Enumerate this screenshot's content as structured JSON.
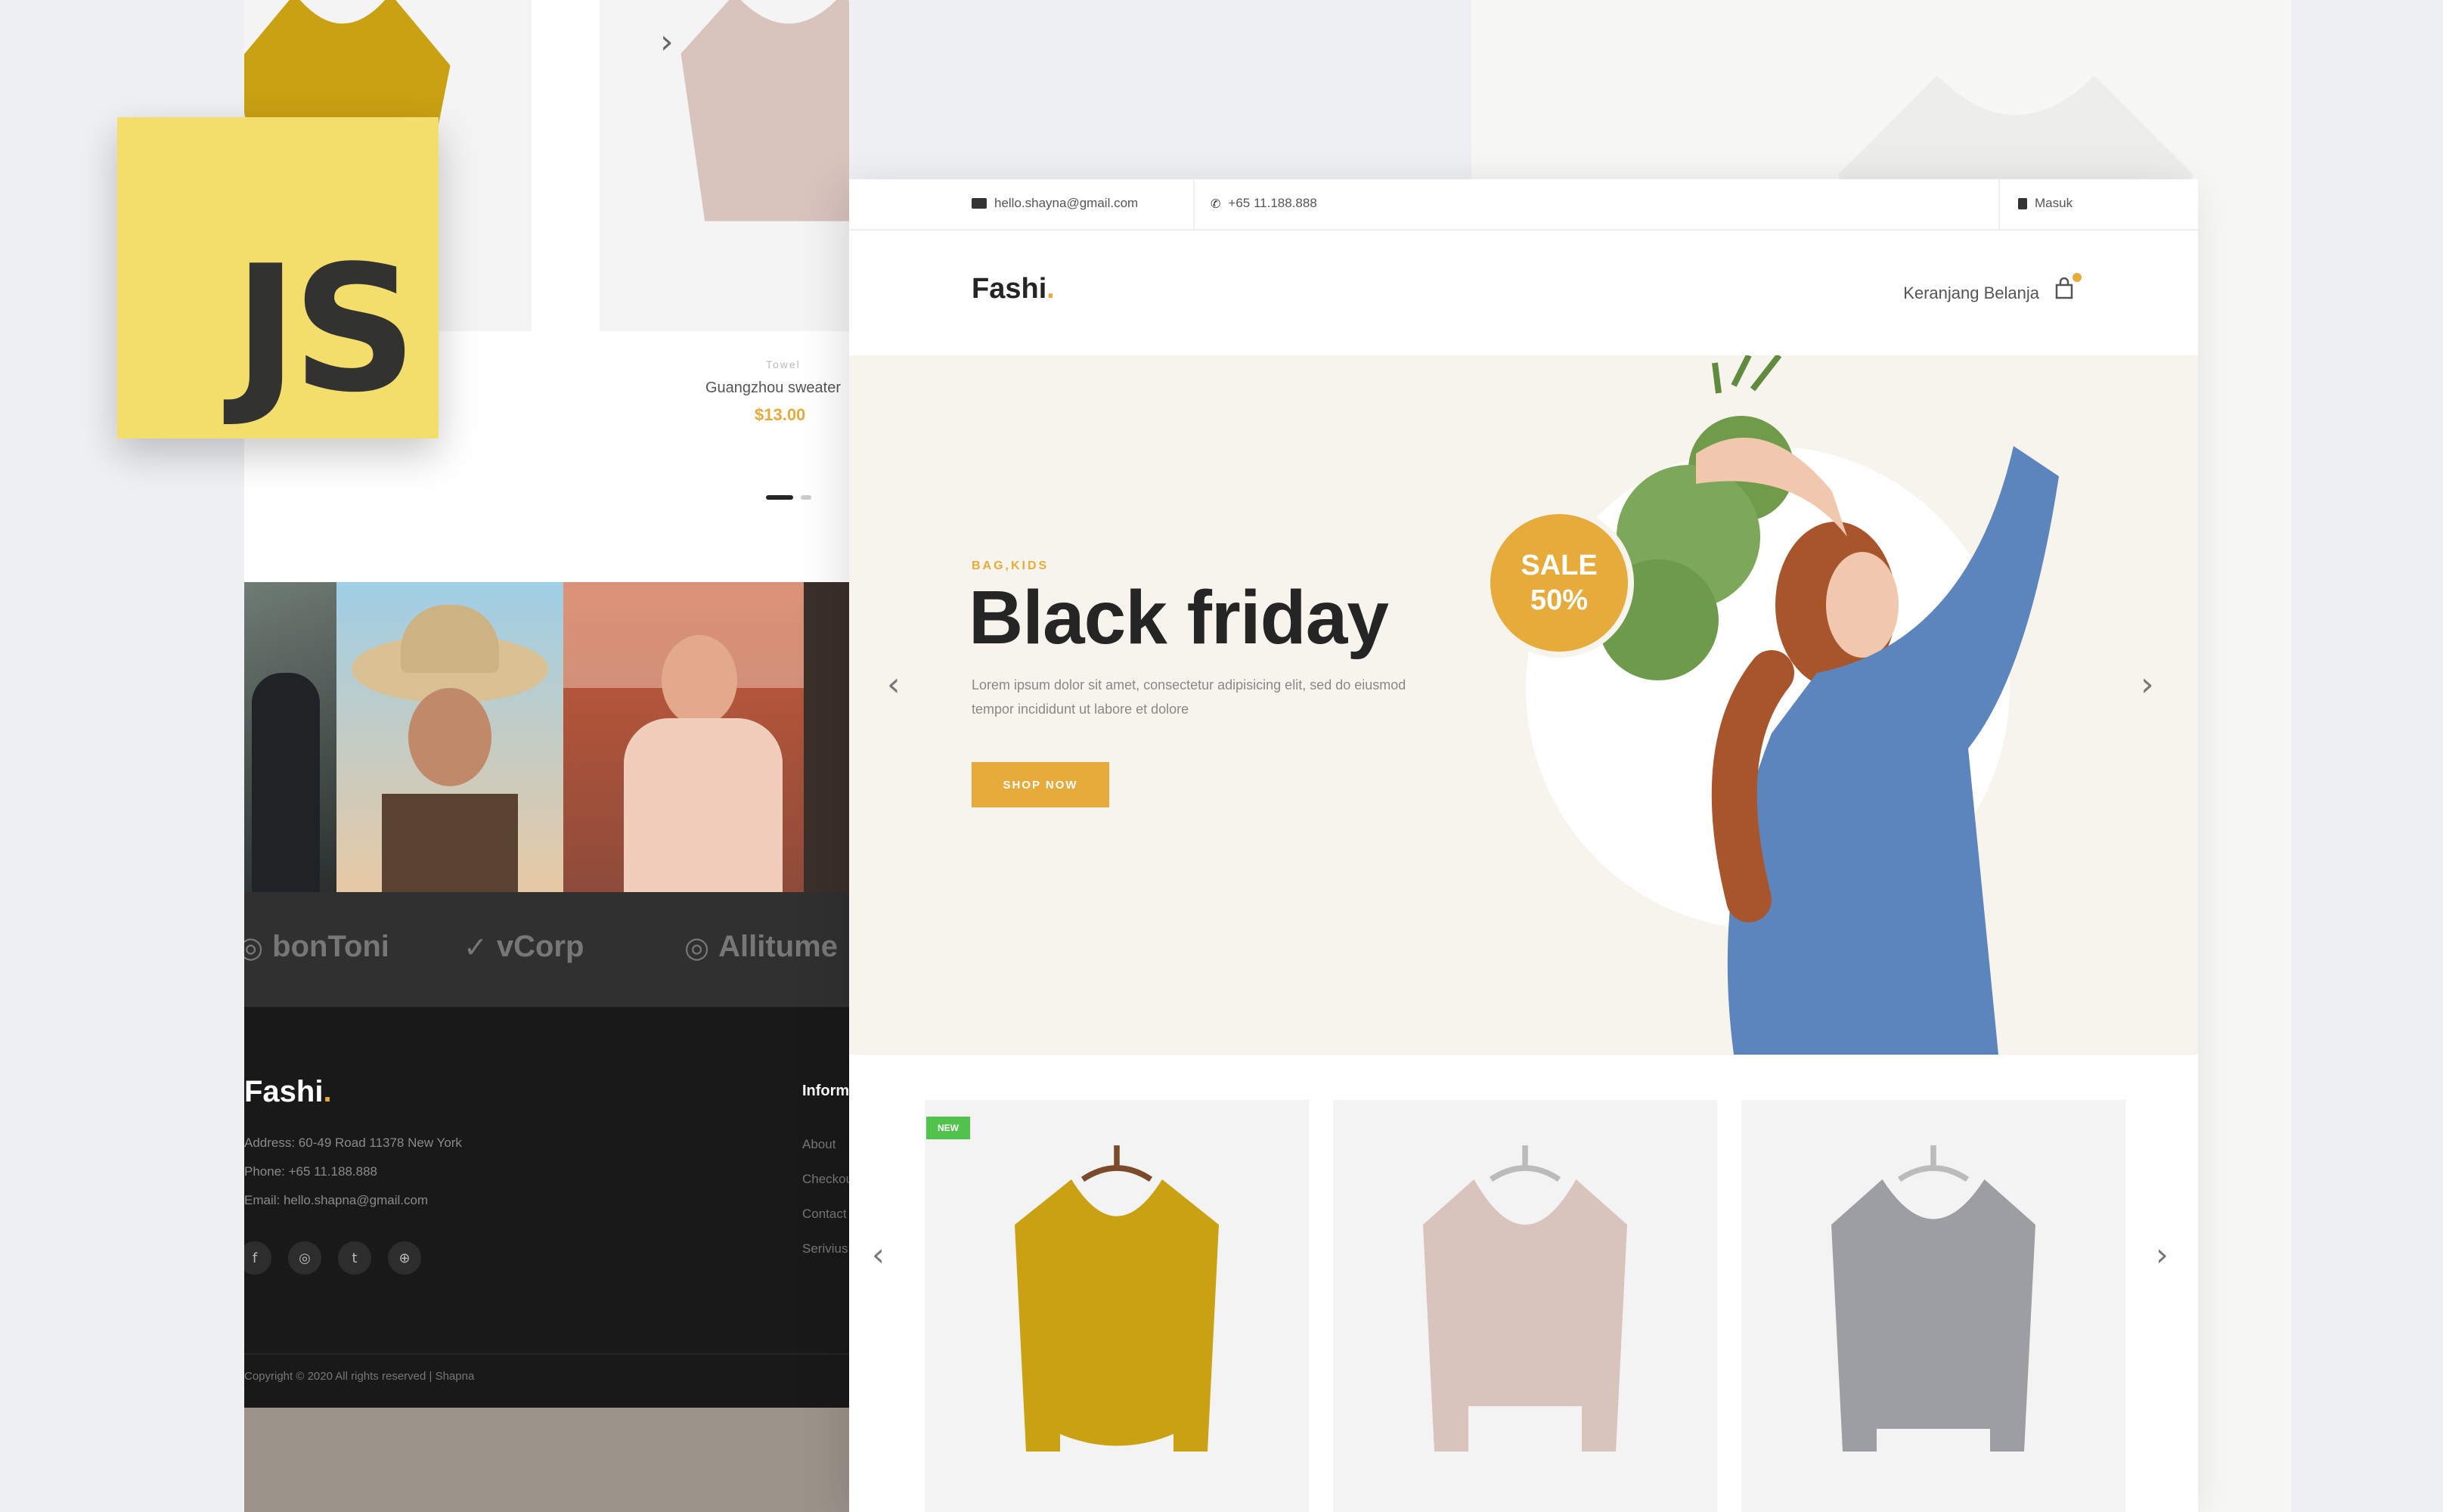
{
  "badge": {
    "text": "JS"
  },
  "left_mock": {
    "product": {
      "category": "Towel",
      "name": "Guangzhou sweater",
      "price": "$13.00"
    },
    "next_arrow": "›",
    "brands": [
      {
        "name": "bonToni",
        "icon": "◎"
      },
      {
        "name": "vCorp",
        "icon": "✓"
      },
      {
        "name": "Allitume",
        "icon": "◎"
      }
    ],
    "footer": {
      "logo": "Fashi",
      "logo_dot": ".",
      "address": "Address: 60-49 Road 11378 New York",
      "phone": "Phone: +65 11.188.888",
      "email": "Email: hello.shapna@gmail.com",
      "info_heading": "Information",
      "links": [
        "About",
        "Checkout",
        "Contact",
        "Serivius"
      ],
      "social": [
        "f",
        "◎",
        "t",
        "⊕"
      ],
      "copyright": "Copyright © 2020 All rights reserved | Shapna"
    }
  },
  "main_mock": {
    "topbar": {
      "email": "hello.shayna@gmail.com",
      "phone": "+65 11.188.888",
      "login": "Masuk"
    },
    "header": {
      "logo": "Fashi",
      "logo_dot": ".",
      "cart_label": "Keranjang Belanja"
    },
    "hero": {
      "eyebrow": "BAG,KIDS",
      "title": "Black friday",
      "description": "Lorem ipsum dolor sit amet, consectetur adipisicing elit, sed do eiusmod tempor incididunt ut labore et dolore",
      "button": "SHOP NOW",
      "sale_line1": "SALE",
      "sale_line2": "50%",
      "prev": "‹",
      "next": "›"
    },
    "products": {
      "new_tag": "NEW",
      "prev": "‹",
      "next": "›",
      "items": [
        {
          "name": "mustard-sweater",
          "color": "#c9a112"
        },
        {
          "name": "pink-sweater",
          "color": "#d8c3bd"
        },
        {
          "name": "grey-sweater",
          "color": "#9d9ea4"
        }
      ]
    }
  },
  "colors": {
    "accent": "#e7ab3c",
    "badge_yellow": "#f3de6b",
    "new_green": "#51c34d",
    "hero_bg": "#f6f4ec"
  }
}
